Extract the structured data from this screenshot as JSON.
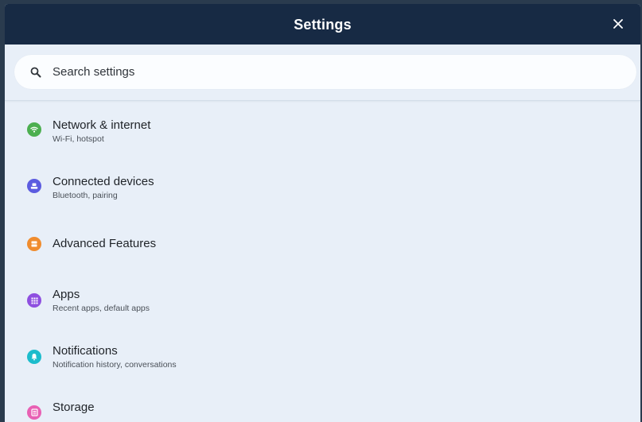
{
  "window": {
    "title": "Settings"
  },
  "search": {
    "placeholder": "Search settings"
  },
  "items": [
    {
      "title": "Network & internet",
      "subtitle": "Wi-Fi, hotspot",
      "icon": "wifi-icon",
      "color": "#4caf50"
    },
    {
      "title": "Connected devices",
      "subtitle": "Bluetooth, pairing",
      "icon": "devices-icon",
      "color": "#5c5ce0"
    },
    {
      "title": "Advanced Features",
      "subtitle": "",
      "icon": "features-icon",
      "color": "#f08c2e"
    },
    {
      "title": "Apps",
      "subtitle": "Recent apps, default apps",
      "icon": "apps-icon",
      "color": "#8e4fe0"
    },
    {
      "title": "Notifications",
      "subtitle": "Notification history, conversations",
      "icon": "bell-icon",
      "color": "#1cbccc"
    },
    {
      "title": "Storage",
      "subtitle": "",
      "icon": "storage-icon",
      "color": "#e860b4"
    }
  ]
}
